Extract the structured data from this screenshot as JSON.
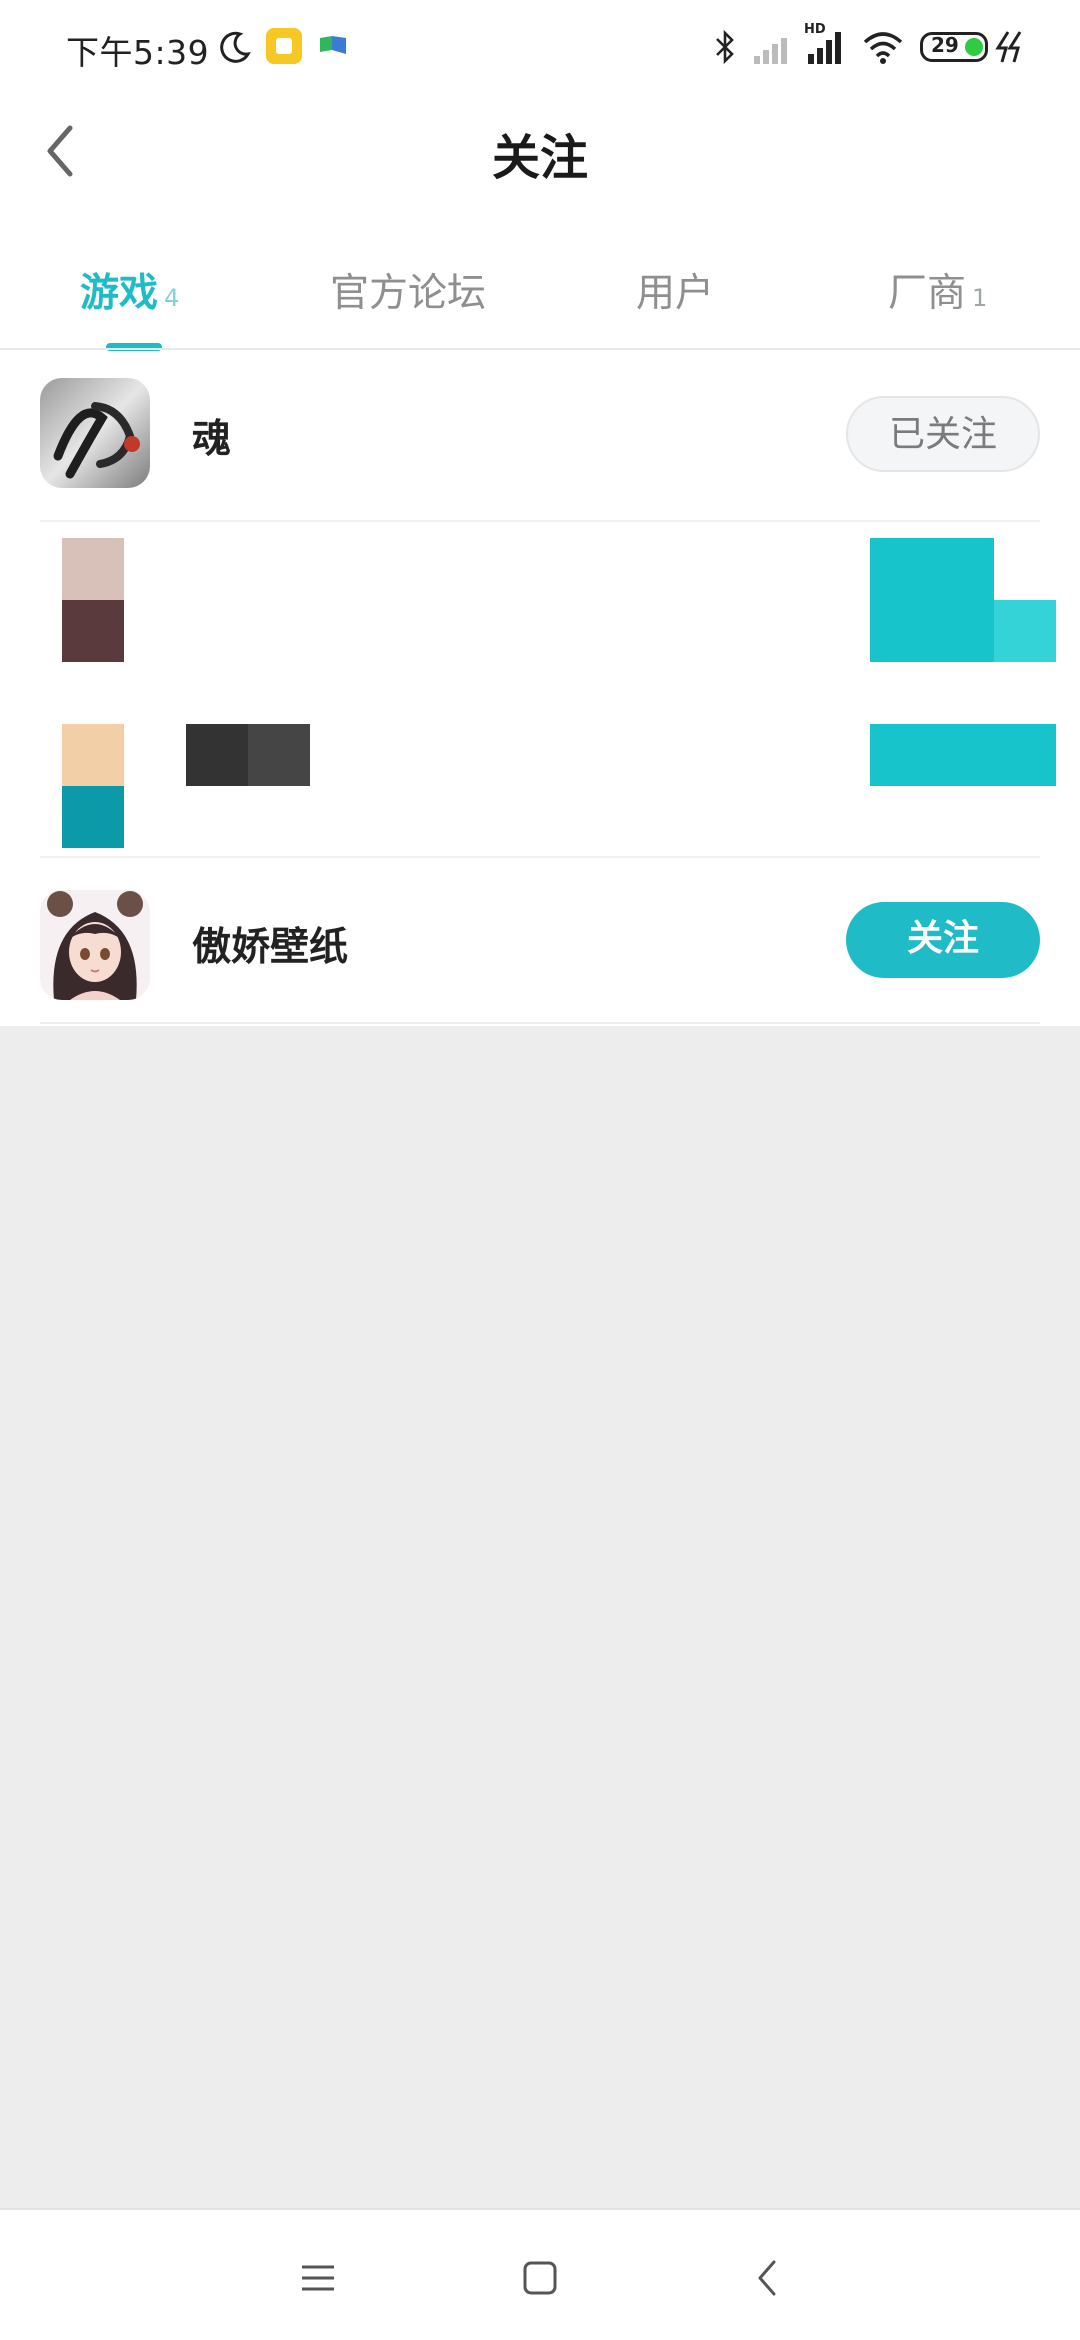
{
  "status_bar": {
    "time": "下午5:39",
    "battery": "29",
    "network_label": "HD"
  },
  "header": {
    "title": "关注"
  },
  "tabs": [
    {
      "label": "游戏",
      "count": "4",
      "active": true
    },
    {
      "label": "官方论坛",
      "count": "",
      "active": false
    },
    {
      "label": "用户",
      "count": "",
      "active": false
    },
    {
      "label": "厂商",
      "count": "1",
      "active": false
    }
  ],
  "list": [
    {
      "name": "魂",
      "button": "已关注",
      "state": "followed"
    },
    {
      "name": "",
      "button": "",
      "state": "obscured"
    },
    {
      "name": "",
      "button": "",
      "state": "obscured"
    },
    {
      "name": "傲娇壁纸",
      "button": "关注",
      "state": "follow"
    }
  ],
  "colors": {
    "accent": "#1fbcc8",
    "background": "#ededed",
    "followed_button_bg": "#f4f5f6"
  },
  "icons": {
    "back": "chevron-left-icon",
    "nav_menu": "menu-icon",
    "nav_home": "home-square-icon",
    "nav_back": "back-triangle-icon"
  }
}
